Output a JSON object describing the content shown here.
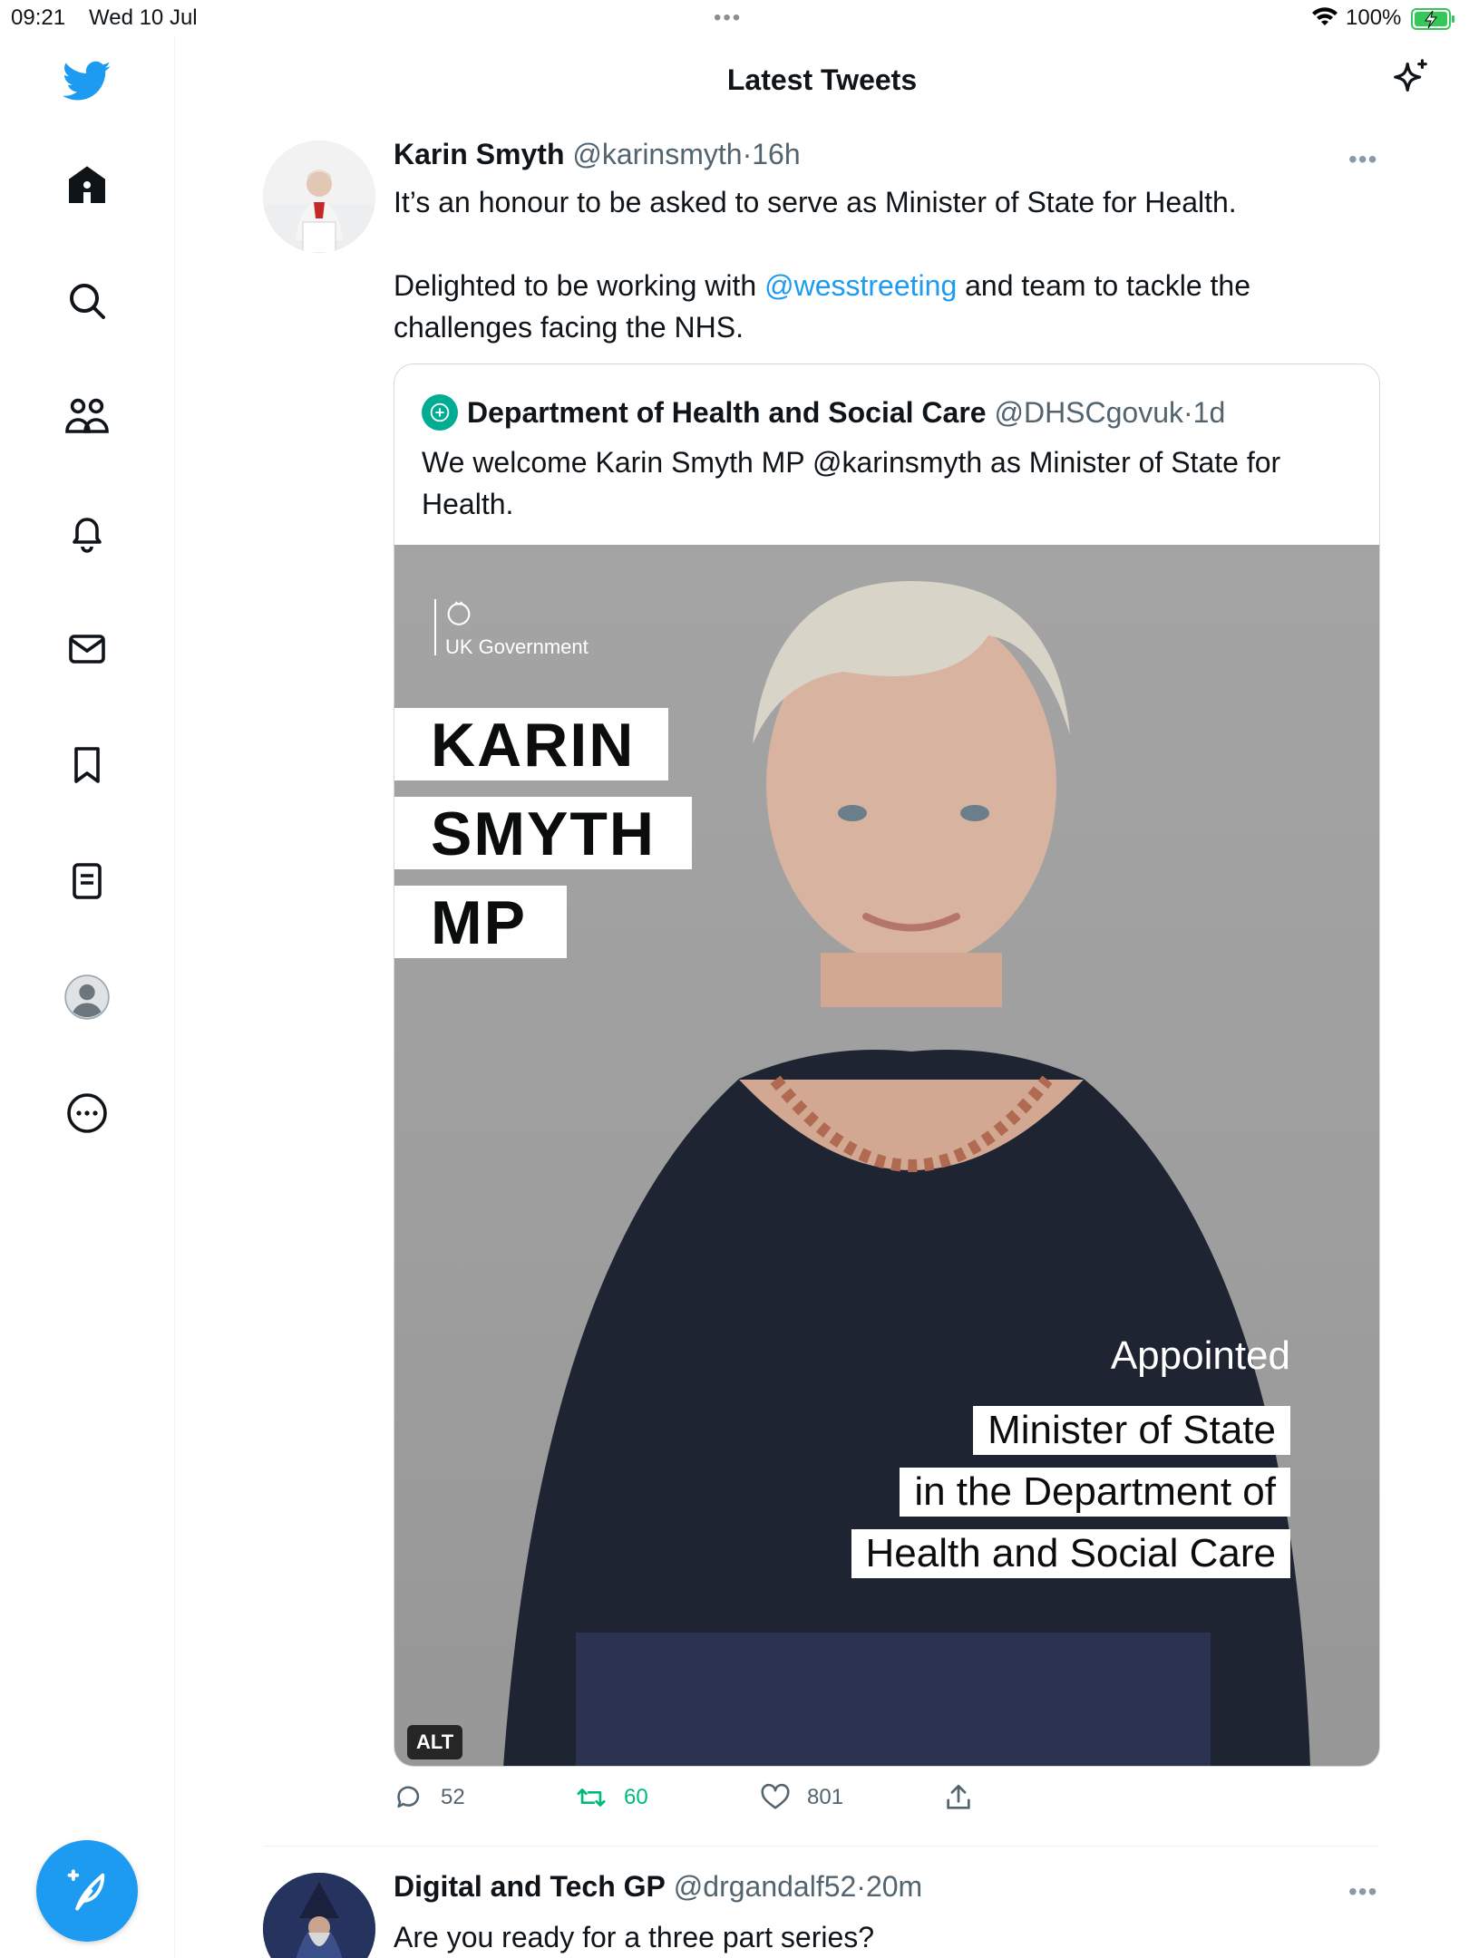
{
  "status_bar": {
    "time": "09:21",
    "date": "Wed 10 Jul",
    "battery": "100%"
  },
  "sidebar": {
    "items": [
      {
        "name": "home",
        "icon": "home-icon"
      },
      {
        "name": "search",
        "icon": "search-icon"
      },
      {
        "name": "communities",
        "icon": "people-icon"
      },
      {
        "name": "notifications",
        "icon": "bell-icon"
      },
      {
        "name": "messages",
        "icon": "envelope-icon"
      },
      {
        "name": "bookmarks",
        "icon": "bookmark-icon"
      },
      {
        "name": "lists",
        "icon": "list-icon"
      },
      {
        "name": "profile",
        "icon": "avatar-icon"
      },
      {
        "name": "more",
        "icon": "more-circle-icon"
      }
    ],
    "compose_icon": "compose-feather-icon"
  },
  "header": {
    "title": "Latest Tweets",
    "sparkle_icon": "sparkle-icon"
  },
  "colors": {
    "brand": "#1d9bf0",
    "text": "#0f1419",
    "muted": "#536471",
    "retweet_active": "#00ba7c",
    "dhsc_logo": "#00ad93"
  },
  "tweet": {
    "author_name": "Karin Smyth",
    "author_handle": "@karinsmyth",
    "separator": "·",
    "time": "16h",
    "text_line1": "It’s an honour to be asked to serve as Minister of State for Health.",
    "text_line2_prefix": "Delighted to be working with ",
    "text_line2_mention": "@wesstreeting",
    "text_line2_suffix": " and team to tackle the challenges facing the NHS.",
    "quote": {
      "author_name": "Department of Health and Social Care",
      "author_handle": "@DHSCgovuk",
      "separator": "·",
      "time": "1d",
      "text": "We welcome Karin Smyth MP @karinsmyth as Minister of State for Health.",
      "media": {
        "gov_label": "UK Government",
        "name_line1": "KARIN",
        "name_line2": "SMYTH",
        "name_line3": "MP",
        "appointed": "Appointed",
        "role_line1": "Minister of State",
        "role_line2": "in the Department of",
        "role_line3": "Health and Social Care",
        "alt_badge": "ALT"
      }
    },
    "actions": {
      "replies": "52",
      "retweets": "60",
      "likes": "801"
    }
  },
  "tweet2": {
    "author_name": "Digital and Tech GP",
    "author_handle": "@drgandalf52",
    "separator": "·",
    "time": "20m",
    "text": "Are you ready for a three part series?"
  }
}
